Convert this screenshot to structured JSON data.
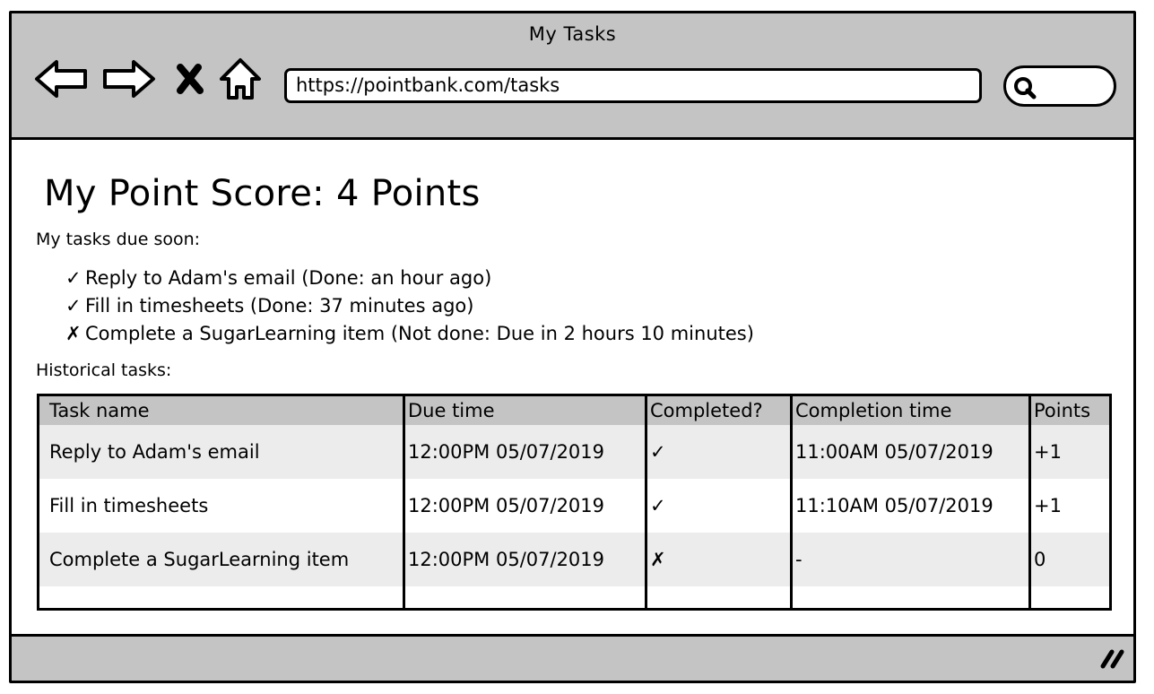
{
  "window": {
    "title": "My Tasks"
  },
  "toolbar": {
    "url": "https://pointbank.com/tasks",
    "icons": [
      "back-arrow-icon",
      "forward-arrow-icon",
      "close-x-icon",
      "home-icon",
      "search-icon"
    ]
  },
  "page": {
    "score_heading": "My Point Score: 4 Points",
    "due_soon_label": "My tasks due soon:",
    "due_soon": [
      {
        "mark": "✓",
        "text": "Reply to Adam's email (Done: an hour ago)"
      },
      {
        "mark": "✓",
        "text": "Fill in timesheets (Done: 37 minutes ago)"
      },
      {
        "mark": "✗",
        "text": "Complete a SugarLearning item (Not done: Due in 2 hours 10 minutes)"
      }
    ],
    "historical_label": "Historical tasks:"
  },
  "table": {
    "headers": [
      "Task name",
      "Due time",
      "Completed?",
      "Completion time",
      "Points"
    ],
    "rows": [
      [
        "Reply to Adam's email",
        "12:00PM 05/07/2019",
        "✓",
        "11:00AM 05/07/2019",
        "+1"
      ],
      [
        "Fill in timesheets",
        "12:00PM 05/07/2019",
        "✓",
        "11:10AM 05/07/2019",
        "+1"
      ],
      [
        "Complete a SugarLearning item",
        "12:00PM 05/07/2019",
        "✗",
        "-",
        "0"
      ]
    ]
  },
  "colors": {
    "chrome_gray": "#c4c4c4",
    "row_stripe": "#ececec",
    "outline": "#000000"
  }
}
